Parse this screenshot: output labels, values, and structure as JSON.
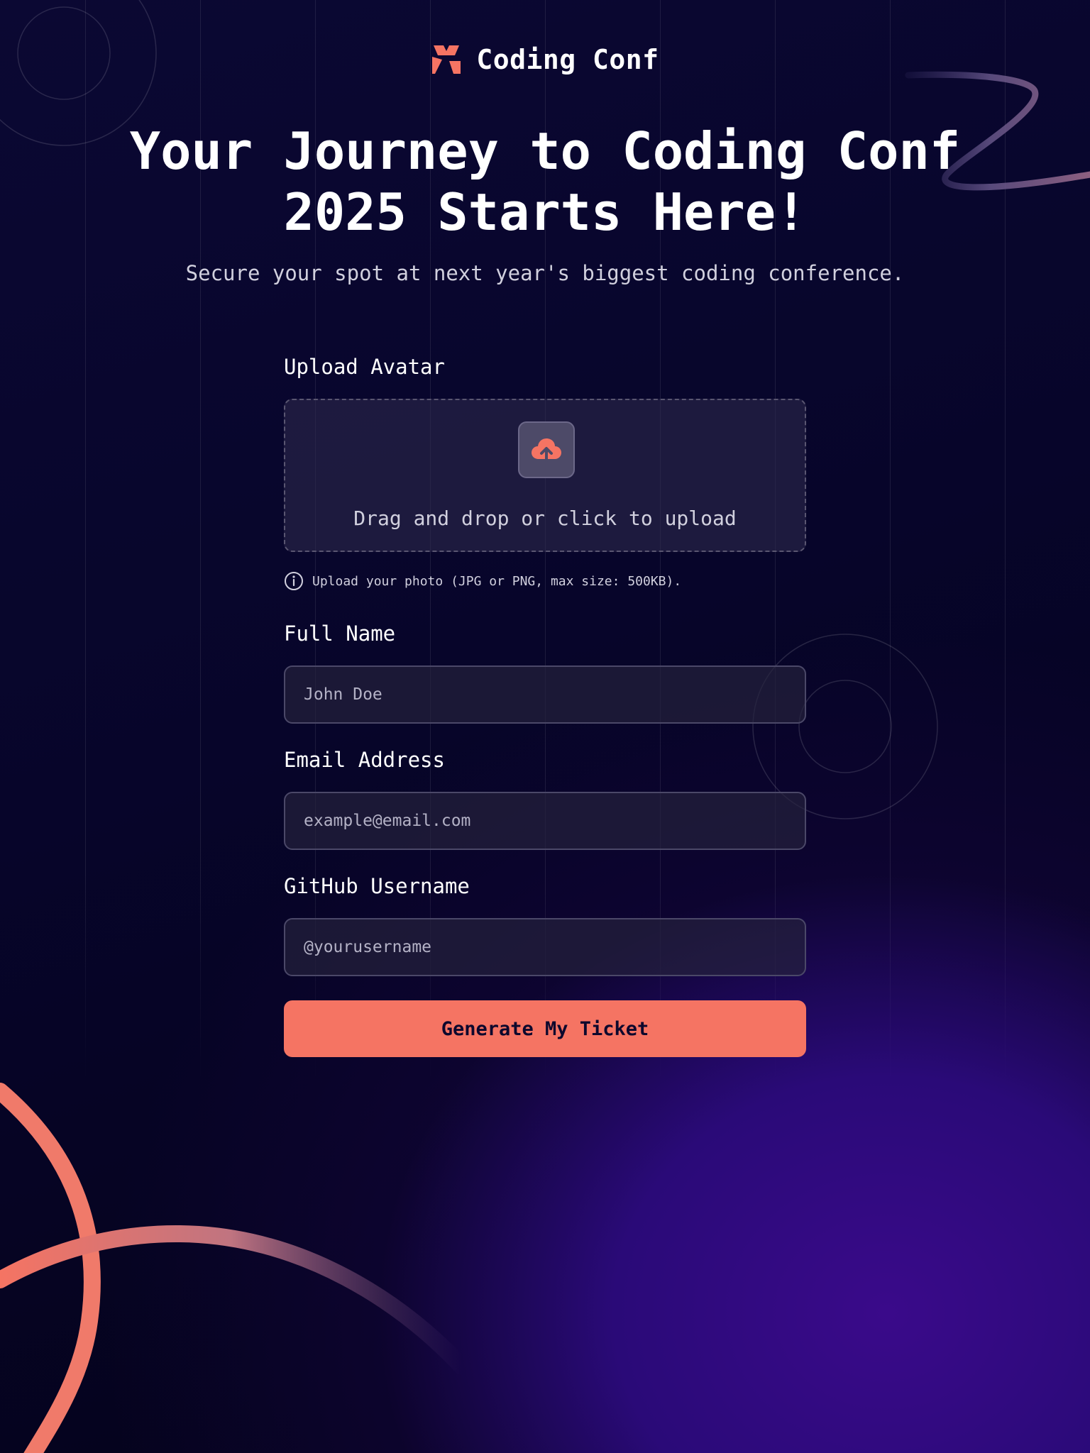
{
  "brand": {
    "name": "Coding Conf",
    "accent_color": "#f57463"
  },
  "hero": {
    "title_line1": "Your Journey to Coding Conf",
    "title_line2": "2025 Starts Here!",
    "subtitle": "Secure your spot at next year's biggest coding conference."
  },
  "form": {
    "avatar": {
      "label": "Upload Avatar",
      "dropzone_text": "Drag and drop or click to upload",
      "icon": "cloud-upload-icon",
      "hint": "Upload your photo (JPG or PNG, max size: 500KB).",
      "hint_icon": "info-icon"
    },
    "full_name": {
      "label": "Full Name",
      "placeholder": "John Doe",
      "value": ""
    },
    "email": {
      "label": "Email Address",
      "placeholder": "example@email.com",
      "value": ""
    },
    "github": {
      "label": "GitHub Username",
      "placeholder": "@yourusername",
      "value": ""
    },
    "submit_label": "Generate My Ticket"
  },
  "colors": {
    "background": "#070524",
    "button": "#f57463",
    "button_text": "#0d082d",
    "field_border": "#4b4868"
  }
}
